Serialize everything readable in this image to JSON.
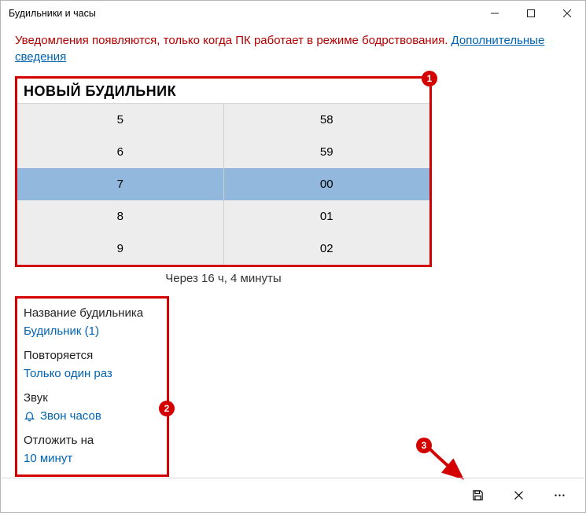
{
  "titlebar": {
    "title": "Будильники и часы"
  },
  "notice": {
    "text": "Уведомления появляются, только когда ПК работает в режиме бодрствования. ",
    "link": "Дополнительные сведения"
  },
  "picker": {
    "title": "НОВЫЙ БУДИЛЬНИК",
    "hours": [
      "5",
      "6",
      "7",
      "8",
      "9"
    ],
    "minutes": [
      "58",
      "59",
      "00",
      "01",
      "02"
    ],
    "selected_index": 2,
    "eta": "Через 16 ч, 4 минуты"
  },
  "settings": {
    "name": {
      "label": "Название будильника",
      "value": "Будильник (1)"
    },
    "repeat": {
      "label": "Повторяется",
      "value": "Только один раз"
    },
    "sound": {
      "label": "Звук",
      "value": "Звон часов"
    },
    "snooze": {
      "label": "Отложить на",
      "value": "10 минут"
    }
  },
  "badges": {
    "one": "1",
    "two": "2",
    "three": "3"
  }
}
